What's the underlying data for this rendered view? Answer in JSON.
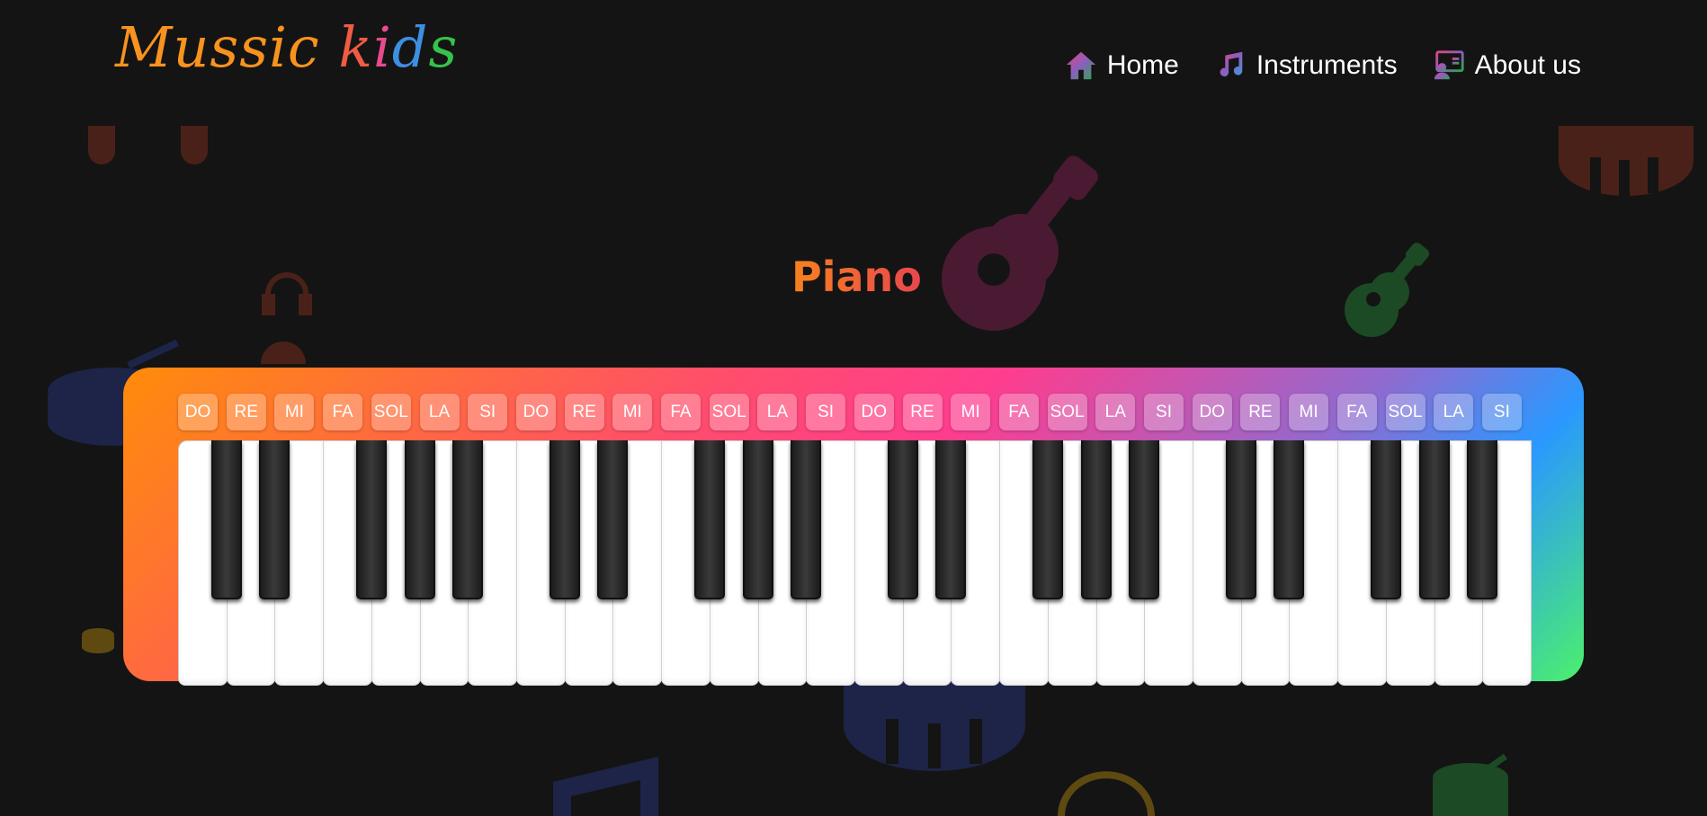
{
  "app": {
    "logo_letters": [
      {
        "ch": "M",
        "color": "#f7931e"
      },
      {
        "ch": "u",
        "color": "#f7931e"
      },
      {
        "ch": "s",
        "color": "#f7931e"
      },
      {
        "ch": "s",
        "color": "#f7931e"
      },
      {
        "ch": "i",
        "color": "#f7931e"
      },
      {
        "ch": "c",
        "color": "#f7931e"
      },
      {
        "ch": " ",
        "color": "#f7931e"
      },
      {
        "ch": "k",
        "color": "#ef5b43"
      },
      {
        "ch": "i",
        "color": "#e84a8d"
      },
      {
        "ch": "d",
        "color": "#3d8fe0"
      },
      {
        "ch": "s",
        "color": "#36c24a"
      }
    ]
  },
  "nav": {
    "items": [
      {
        "label": "Home",
        "icon": "home-icon"
      },
      {
        "label": "Instruments",
        "icon": "music-note-icon"
      },
      {
        "label": "About us",
        "icon": "about-us-icon"
      }
    ]
  },
  "page": {
    "title": "Piano"
  },
  "piano": {
    "note_labels": [
      "DO",
      "RE",
      "MI",
      "FA",
      "SOL",
      "LA",
      "SI",
      "DO",
      "RE",
      "MI",
      "FA",
      "SOL",
      "LA",
      "SI",
      "DO",
      "RE",
      "MI",
      "FA",
      "SOL",
      "LA",
      "SI",
      "DO",
      "RE",
      "MI",
      "FA",
      "SOL",
      "LA",
      "SI"
    ],
    "octaves": 4
  },
  "colors": {
    "background": "#141414",
    "gradient": [
      "#ff8c0a",
      "#ff3d8e",
      "#8f6bd0",
      "#2a98ff",
      "#4cf06c"
    ]
  },
  "decorations": [
    "drum-icon",
    "headphones-icon",
    "guitar-icon",
    "drum-icon",
    "guitar-icon",
    "drum-icon",
    "note-icon"
  ]
}
